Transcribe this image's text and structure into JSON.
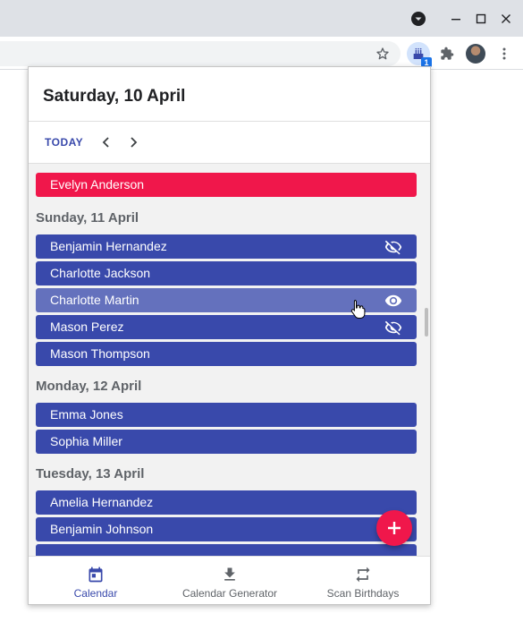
{
  "popup": {
    "header_title": "Saturday, 10 April",
    "today_label": "TODAY",
    "today_birthdays": [
      {
        "name": "Evelyn Anderson"
      }
    ],
    "days": [
      {
        "label": "Sunday, 11 April",
        "birthdays": [
          {
            "name": "Benjamin Hernandez",
            "icon": "eye-off-icon"
          },
          {
            "name": "Charlotte Jackson",
            "icon": ""
          },
          {
            "name": "Charlotte Martin",
            "icon": "eye-icon"
          },
          {
            "name": "Mason Perez",
            "icon": "eye-off-icon"
          },
          {
            "name": "Mason Thompson",
            "icon": ""
          }
        ]
      },
      {
        "label": "Monday, 12 April",
        "birthdays": [
          {
            "name": "Emma Jones"
          },
          {
            "name": "Sophia Miller"
          }
        ]
      },
      {
        "label": "Tuesday, 13 April",
        "birthdays": [
          {
            "name": "Amelia Hernandez"
          },
          {
            "name": "Benjamin Johnson"
          }
        ]
      }
    ],
    "bottom_nav": [
      {
        "label": "Calendar",
        "icon": "calendar-icon",
        "active": true
      },
      {
        "label": "Calendar Generator",
        "icon": "download-icon",
        "active": false
      },
      {
        "label": "Scan Birthdays",
        "icon": "swap-icon",
        "active": false
      }
    ]
  },
  "toolbar": {
    "extension_badge": "1"
  },
  "colors": {
    "primary": "#3949ab",
    "today": "#f0174b",
    "hover_row": "#6471bd"
  }
}
